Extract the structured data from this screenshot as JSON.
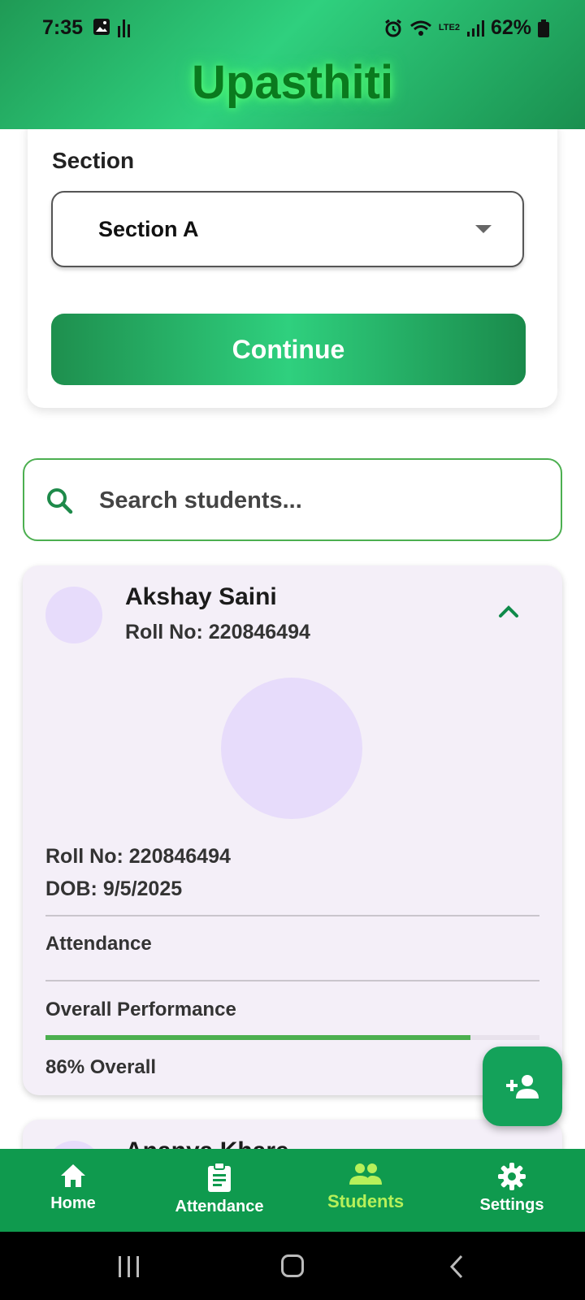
{
  "status_bar": {
    "time": "7:35",
    "battery": "62%",
    "network": "LTE2"
  },
  "app": {
    "title": "Upasthiti"
  },
  "section_card": {
    "label": "Section",
    "selected": "Section A",
    "continue_label": "Continue"
  },
  "search": {
    "placeholder": "Search students..."
  },
  "students": [
    {
      "name": "Akshay Saini",
      "roll_header": "Roll No: 220846494",
      "roll_detail": "Roll No: 220846494",
      "dob": "DOB: 9/5/2025",
      "attendance_label": "Attendance",
      "performance_label": "Overall Performance",
      "performance_value": 0.86,
      "overall_text": "86% Overall",
      "expanded": true
    },
    {
      "name": "Ananya Khare"
    }
  ],
  "fab": {
    "icon": "add-person-icon"
  },
  "nav": {
    "items": [
      {
        "label": "Home",
        "icon": "home-icon"
      },
      {
        "label": "Attendance",
        "icon": "clipboard-icon"
      },
      {
        "label": "Students",
        "icon": "people-icon",
        "active": true
      },
      {
        "label": "Settings",
        "icon": "gear-icon"
      }
    ]
  },
  "colors": {
    "primary": "#0f9a4e",
    "accent_active": "#b6f05a",
    "title_glow": "#0a7a1e",
    "card_bg": "#f4eff8",
    "avatar_bg": "#e7dcfb",
    "progress": "#4caf50"
  }
}
